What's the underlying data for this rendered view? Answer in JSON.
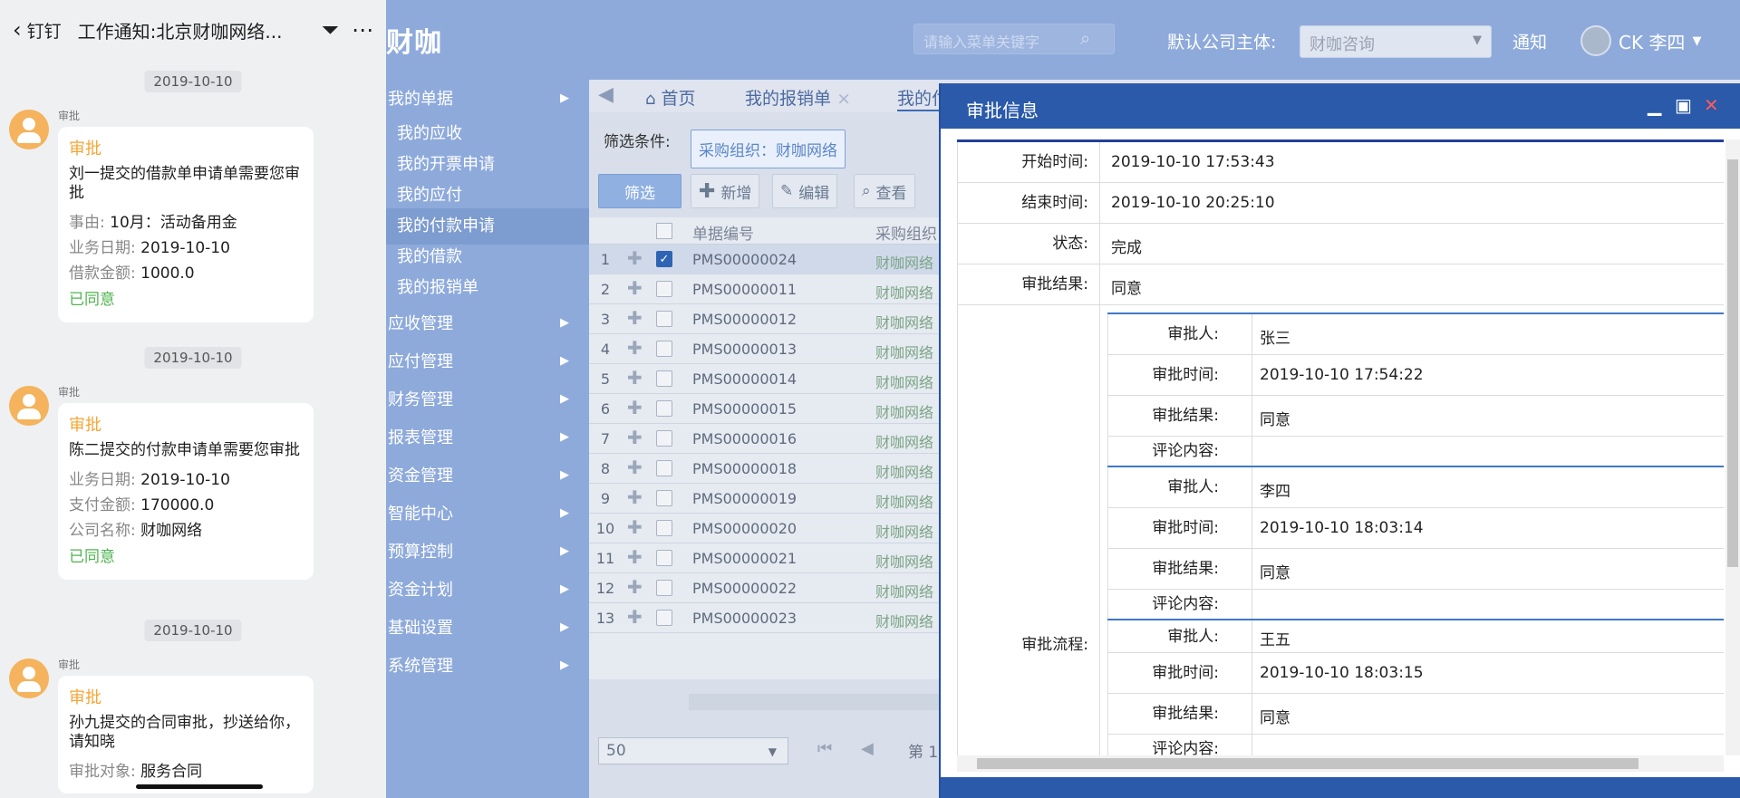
{
  "phone": {
    "back_label": "钉钉",
    "title": "工作通知:北京财咖网络...",
    "messages": [
      {
        "date": "2019-10-10",
        "sender": "审批",
        "type": "审批",
        "desc": "刘一提交的借款单申请单需要您审批",
        "fields": [
          {
            "k": "事由:",
            "v": "10月：活动备用金"
          },
          {
            "k": "业务日期:",
            "v": "2019-10-10"
          },
          {
            "k": "借款金额:",
            "v": "1000.0"
          }
        ],
        "status": "已同意"
      },
      {
        "date": "2019-10-10",
        "sender": "审批",
        "type": "审批",
        "desc": "陈二提交的付款申请单需要您审批",
        "fields": [
          {
            "k": "业务日期:",
            "v": "2019-10-10"
          },
          {
            "k": "支付金额:",
            "v": "170000.0"
          },
          {
            "k": "公司名称:",
            "v": "财咖网络"
          }
        ],
        "status": "已同意"
      },
      {
        "date": "2019-10-10",
        "sender": "审批",
        "type": "审批",
        "desc": "孙九提交的合同审批，抄送给你，请知晓",
        "fields": [
          {
            "k": "审批对象:",
            "v": "服务合同"
          }
        ],
        "status": ""
      }
    ]
  },
  "header": {
    "logo": "财咖",
    "search_placeholder": "请输入菜单关键字",
    "company_label": "默认公司主体:",
    "company_value": "财咖咨询",
    "notify": "通知",
    "user": "CK 李四"
  },
  "sidebar": {
    "items": [
      {
        "label": "我的单据",
        "type": "group"
      },
      {
        "label": "我的应收",
        "type": "sub"
      },
      {
        "label": "我的开票申请",
        "type": "sub"
      },
      {
        "label": "我的应付",
        "type": "sub"
      },
      {
        "label": "我的付款申请",
        "type": "sub",
        "active": true
      },
      {
        "label": "我的借款",
        "type": "sub"
      },
      {
        "label": "我的报销单",
        "type": "sub"
      },
      {
        "label": "应收管理",
        "type": "group"
      },
      {
        "label": "应付管理",
        "type": "group"
      },
      {
        "label": "财务管理",
        "type": "group"
      },
      {
        "label": "报表管理",
        "type": "group"
      },
      {
        "label": "资金管理",
        "type": "group"
      },
      {
        "label": "智能中心",
        "type": "group"
      },
      {
        "label": "预算控制",
        "type": "group"
      },
      {
        "label": "资金计划",
        "type": "group"
      },
      {
        "label": "基础设置",
        "type": "group"
      },
      {
        "label": "系统管理",
        "type": "group"
      }
    ]
  },
  "tabs": [
    {
      "label": "首页"
    },
    {
      "label": "我的报销单"
    },
    {
      "label": "我的付"
    }
  ],
  "filter": {
    "label": "筛选条件:",
    "tag": "采购组织：财咖网络"
  },
  "toolbar": {
    "filter": "筛选",
    "add": "新增",
    "edit": "编辑",
    "view": "查看"
  },
  "grid": {
    "col_code": "单据编号",
    "col_org": "采购组织",
    "rows": [
      {
        "n": "1",
        "code": "PMS00000024",
        "org": "财咖网络",
        "checked": true
      },
      {
        "n": "2",
        "code": "PMS00000011",
        "org": "财咖网络"
      },
      {
        "n": "3",
        "code": "PMS00000012",
        "org": "财咖网络"
      },
      {
        "n": "4",
        "code": "PMS00000013",
        "org": "财咖网络"
      },
      {
        "n": "5",
        "code": "PMS00000014",
        "org": "财咖网络"
      },
      {
        "n": "6",
        "code": "PMS00000015",
        "org": "财咖网络"
      },
      {
        "n": "7",
        "code": "PMS00000016",
        "org": "财咖网络"
      },
      {
        "n": "8",
        "code": "PMS00000018",
        "org": "财咖网络"
      },
      {
        "n": "9",
        "code": "PMS00000019",
        "org": "财咖网络"
      },
      {
        "n": "10",
        "code": "PMS00000020",
        "org": "财咖网络"
      },
      {
        "n": "11",
        "code": "PMS00000021",
        "org": "财咖网络"
      },
      {
        "n": "12",
        "code": "PMS00000022",
        "org": "财咖网络"
      },
      {
        "n": "13",
        "code": "PMS00000023",
        "org": "财咖网络"
      }
    ]
  },
  "pager": {
    "size": "50",
    "page_label": "第 1"
  },
  "dialog": {
    "title": "审批信息",
    "fields": [
      {
        "k": "开始时间:",
        "v": "2019-10-10 17:53:43"
      },
      {
        "k": "结束时间:",
        "v": "2019-10-10 20:25:10"
      },
      {
        "k": "状态:",
        "v": "完成"
      },
      {
        "k": "审批结果:",
        "v": "同意"
      }
    ],
    "flow_label": "审批流程:",
    "flow": [
      {
        "approver": "张三",
        "time": "2019-10-10 17:54:22",
        "result": "同意",
        "comment": ""
      },
      {
        "approver": "李四",
        "time": "2019-10-10 18:03:14",
        "result": "同意",
        "comment": ""
      },
      {
        "approver": "王五",
        "time": "2019-10-10 18:03:15",
        "result": "同意",
        "comment": ""
      }
    ],
    "sub_labels": {
      "approver": "审批人:",
      "time": "审批时间:",
      "result": "审批结果:",
      "comment": "评论内容:"
    }
  }
}
